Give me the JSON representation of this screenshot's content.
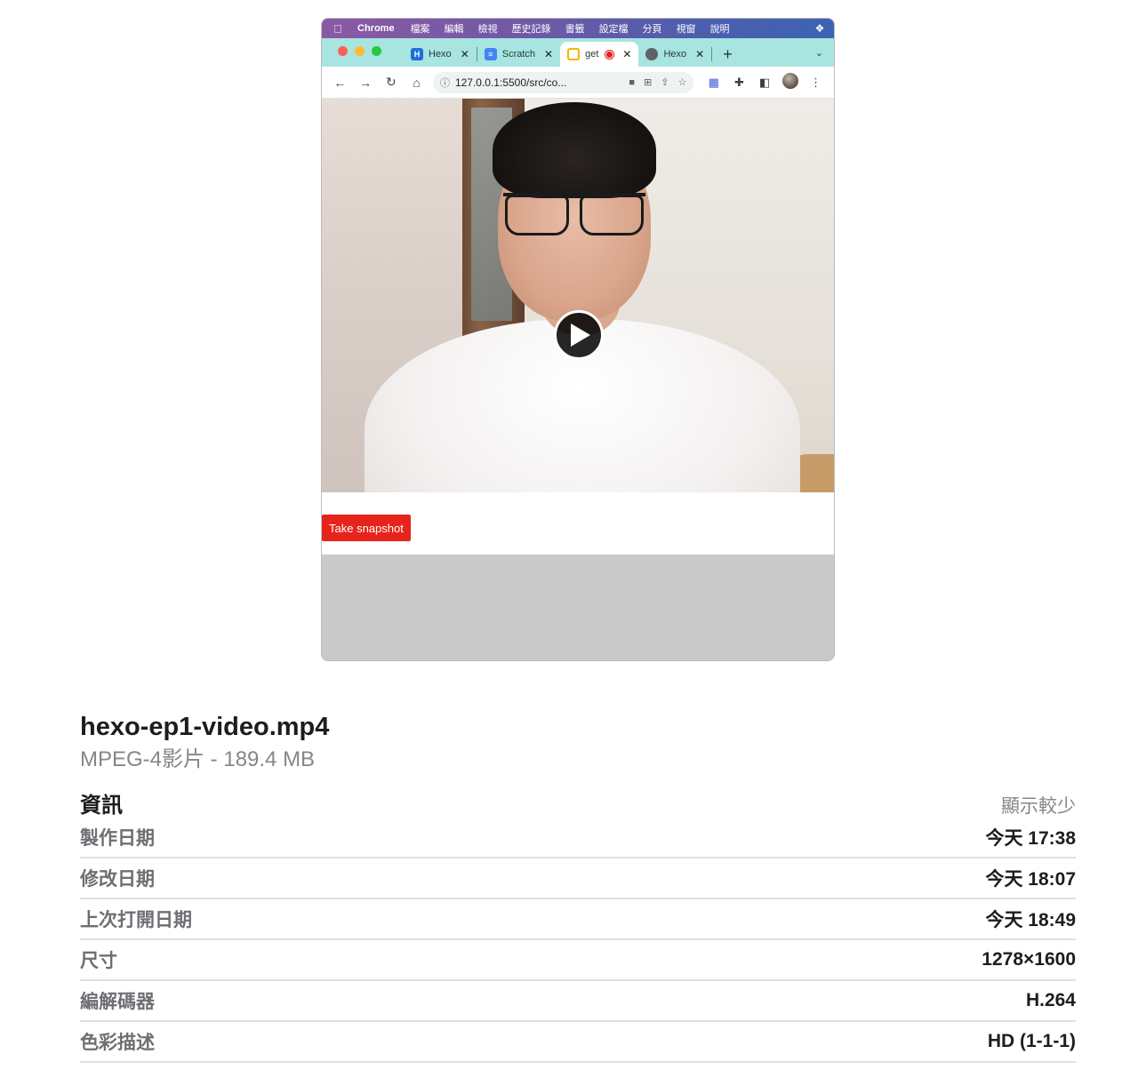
{
  "menubar": {
    "app": "Chrome",
    "items": [
      "檔案",
      "編輯",
      "檢視",
      "歷史記錄",
      "書籤",
      "設定檔",
      "分頁",
      "視窗",
      "說明"
    ]
  },
  "tabs": [
    {
      "title": "Hexo",
      "favicon": "H",
      "color": "#1e6fd9"
    },
    {
      "title": "Scratch",
      "favicon": "≡",
      "color": "#4285f4"
    },
    {
      "title": "get",
      "favicon": "◎",
      "color": "#e94235",
      "active": true
    },
    {
      "title": "Hexo",
      "favicon": "◉",
      "color": "#5f6368"
    }
  ],
  "address_bar": {
    "url": "127.0.0.1:5500/src/co..."
  },
  "video": {
    "play_label": "Play"
  },
  "page": {
    "snapshot_button": "Take snapshot"
  },
  "file": {
    "name": "hexo-ep1-video.mp4",
    "kind": "MPEG-4影片 - 189.4 MB"
  },
  "info": {
    "title": "資訊",
    "toggle": "顯示較少",
    "rows": [
      {
        "label": "製作日期",
        "value": "今天 17:38"
      },
      {
        "label": "修改日期",
        "value": "今天 18:07"
      },
      {
        "label": "上次打開日期",
        "value": "今天 18:49"
      },
      {
        "label": "尺寸",
        "value": "1278×1600"
      },
      {
        "label": "編解碼器",
        "value": "H.264"
      },
      {
        "label": "色彩描述",
        "value": "HD (1-1-1)"
      }
    ]
  }
}
